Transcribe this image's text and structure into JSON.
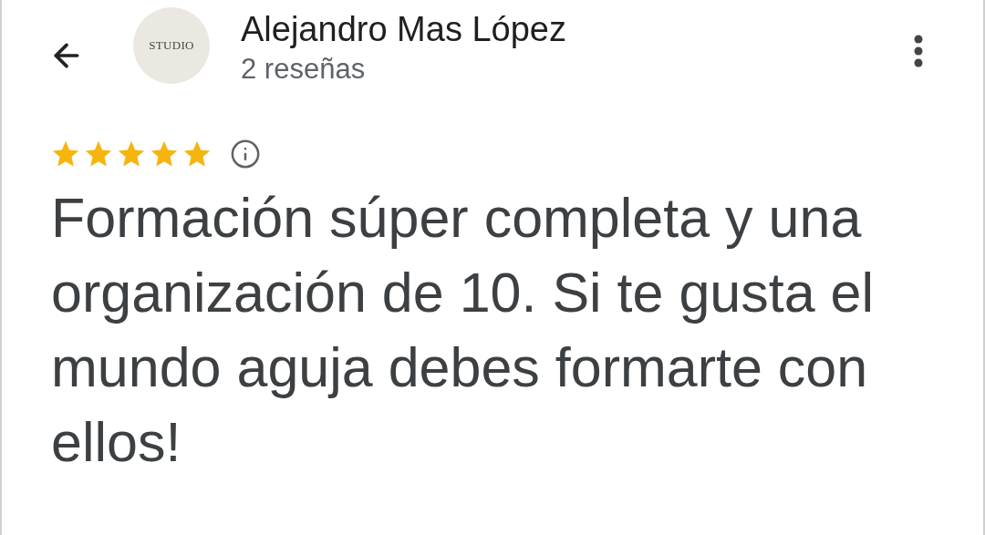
{
  "header": {
    "avatar_text": "STUDIO",
    "name": "Alejandro Mas López",
    "subtitle": "2 reseñas"
  },
  "review": {
    "stars": 5,
    "text": "Formación súper completa y una organización de 10. Si te gusta el mundo aguja debes formarte con ellos!"
  }
}
